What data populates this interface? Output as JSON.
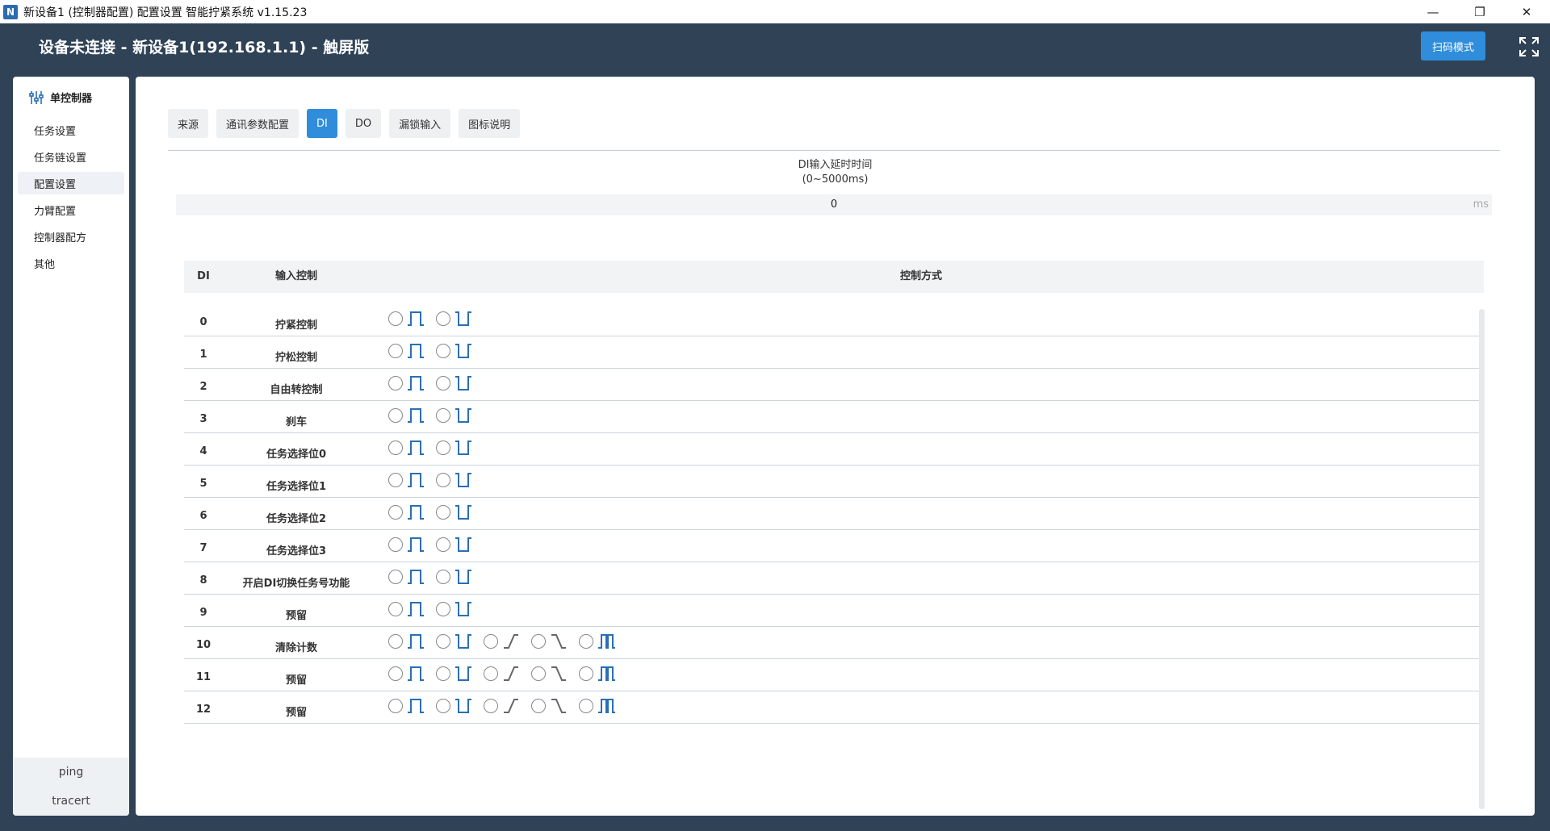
{
  "window": {
    "title": "新设备1 (控制器配置) 配置设置 智能拧紧系统 v1.15.23",
    "app_icon_glyph": "N",
    "minimize": "—",
    "restore": "❐",
    "close": "✕"
  },
  "header": {
    "title": "设备未连接 - 新设备1(192.168.1.1) - 触屏版",
    "scan_button": "扫码模式"
  },
  "sidebar": {
    "heading": "单控制器",
    "items": [
      {
        "label": "任务设置"
      },
      {
        "label": "任务链设置"
      },
      {
        "label": "配置设置",
        "active": true
      },
      {
        "label": "力臂配置"
      },
      {
        "label": "控制器配方"
      },
      {
        "label": "其他"
      }
    ],
    "tools": [
      "ping",
      "tracert"
    ]
  },
  "tabs": [
    {
      "label": "来源"
    },
    {
      "label": "通讯参数配置"
    },
    {
      "label": "DI",
      "active": true
    },
    {
      "label": "DO"
    },
    {
      "label": "漏锁输入"
    },
    {
      "label": "图标说明"
    }
  ],
  "delay": {
    "label": "DI输入延时时间",
    "range": "(0~5000ms)",
    "value": "0",
    "unit": "ms"
  },
  "table": {
    "headers": {
      "di": "DI",
      "input": "输入控制",
      "mode": "控制方式"
    },
    "rows": [
      {
        "di": "0",
        "input": "拧紧控制",
        "modes": [
          "rising",
          "falling"
        ]
      },
      {
        "di": "1",
        "input": "拧松控制",
        "modes": [
          "rising",
          "falling"
        ]
      },
      {
        "di": "2",
        "input": "自由转控制",
        "modes": [
          "rising",
          "falling"
        ]
      },
      {
        "di": "3",
        "input": "刹车",
        "modes": [
          "rising",
          "falling"
        ]
      },
      {
        "di": "4",
        "input": "任务选择位0",
        "modes": [
          "rising",
          "falling"
        ]
      },
      {
        "di": "5",
        "input": "任务选择位1",
        "modes": [
          "rising",
          "falling"
        ]
      },
      {
        "di": "6",
        "input": "任务选择位2",
        "modes": [
          "rising",
          "falling"
        ]
      },
      {
        "di": "7",
        "input": "任务选择位3",
        "modes": [
          "rising",
          "falling"
        ]
      },
      {
        "di": "8",
        "input": "开启DI切换任务号功能",
        "modes": [
          "rising",
          "falling"
        ]
      },
      {
        "di": "9",
        "input": "预留",
        "modes": [
          "rising",
          "falling"
        ]
      },
      {
        "di": "10",
        "input": "清除计数",
        "modes": [
          "rising",
          "falling",
          "high-level",
          "low-level",
          "pulse"
        ]
      },
      {
        "di": "11",
        "input": "预留",
        "modes": [
          "rising",
          "falling",
          "high-level",
          "low-level",
          "pulse"
        ]
      },
      {
        "di": "12",
        "input": "预留",
        "modes": [
          "rising",
          "falling",
          "high-level",
          "low-level",
          "pulse"
        ]
      }
    ]
  },
  "colors": {
    "accent": "#2f8ddb",
    "header_bg": "#2f4256",
    "wave_blue": "#2a6fb5",
    "wave_gray": "#666666"
  }
}
